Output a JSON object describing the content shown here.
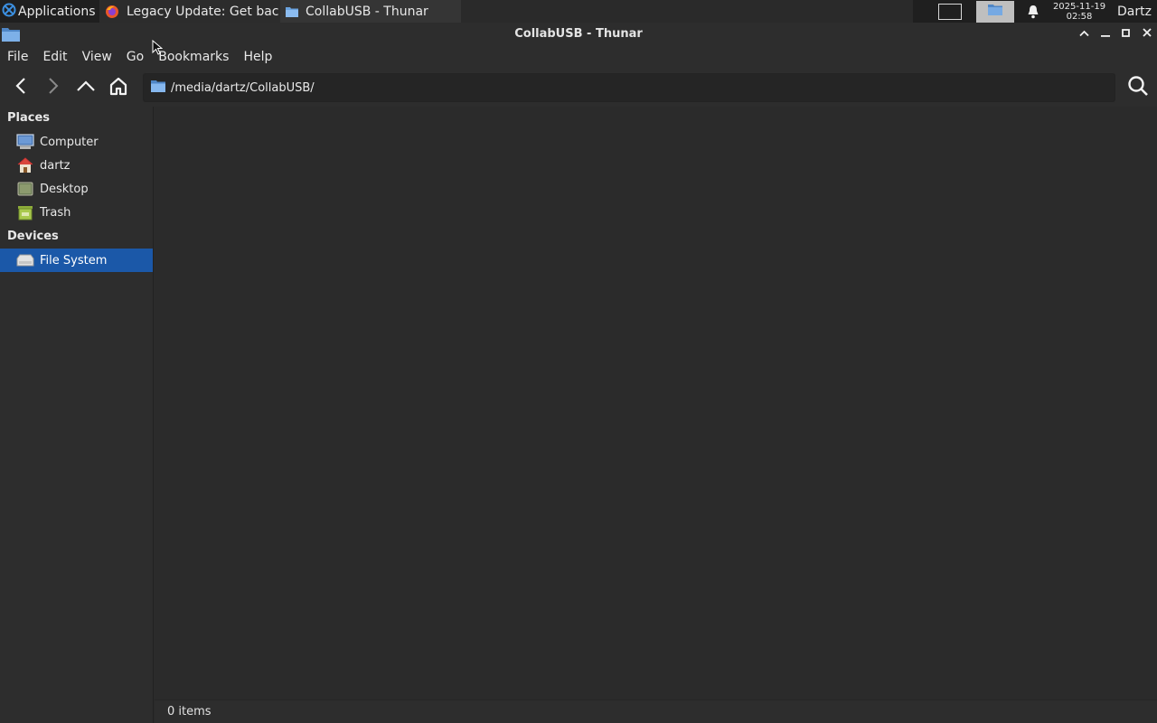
{
  "taskbar": {
    "applications_label": "Applications",
    "applications_icon": "xfce-logo-icon",
    "tasks": [
      {
        "label": "Legacy Update: Get bac...",
        "icon": "firefox-icon"
      },
      {
        "label": "CollabUSB - Thunar",
        "icon": "folder-icon"
      }
    ],
    "clock_date": "2025-11-19",
    "clock_time": "02:58",
    "user": "Dartz"
  },
  "window": {
    "title": "CollabUSB - Thunar"
  },
  "menu": {
    "items": [
      "File",
      "Edit",
      "View",
      "Go",
      "Bookmarks",
      "Help"
    ]
  },
  "toolbar": {
    "location_path": "/media/dartz/CollabUSB/"
  },
  "sidebar": {
    "places_title": "Places",
    "places": [
      {
        "label": "Computer",
        "icon": "computer-icon"
      },
      {
        "label": "dartz",
        "icon": "home-icon"
      },
      {
        "label": "Desktop",
        "icon": "desktop-icon"
      },
      {
        "label": "Trash",
        "icon": "trash-icon"
      }
    ],
    "devices_title": "Devices",
    "devices": [
      {
        "label": "File System",
        "icon": "drive-icon",
        "selected": true
      }
    ]
  },
  "status": {
    "text": "0 items"
  },
  "colors": {
    "selection": "#1b58a8",
    "background": "#2b2b2b"
  }
}
